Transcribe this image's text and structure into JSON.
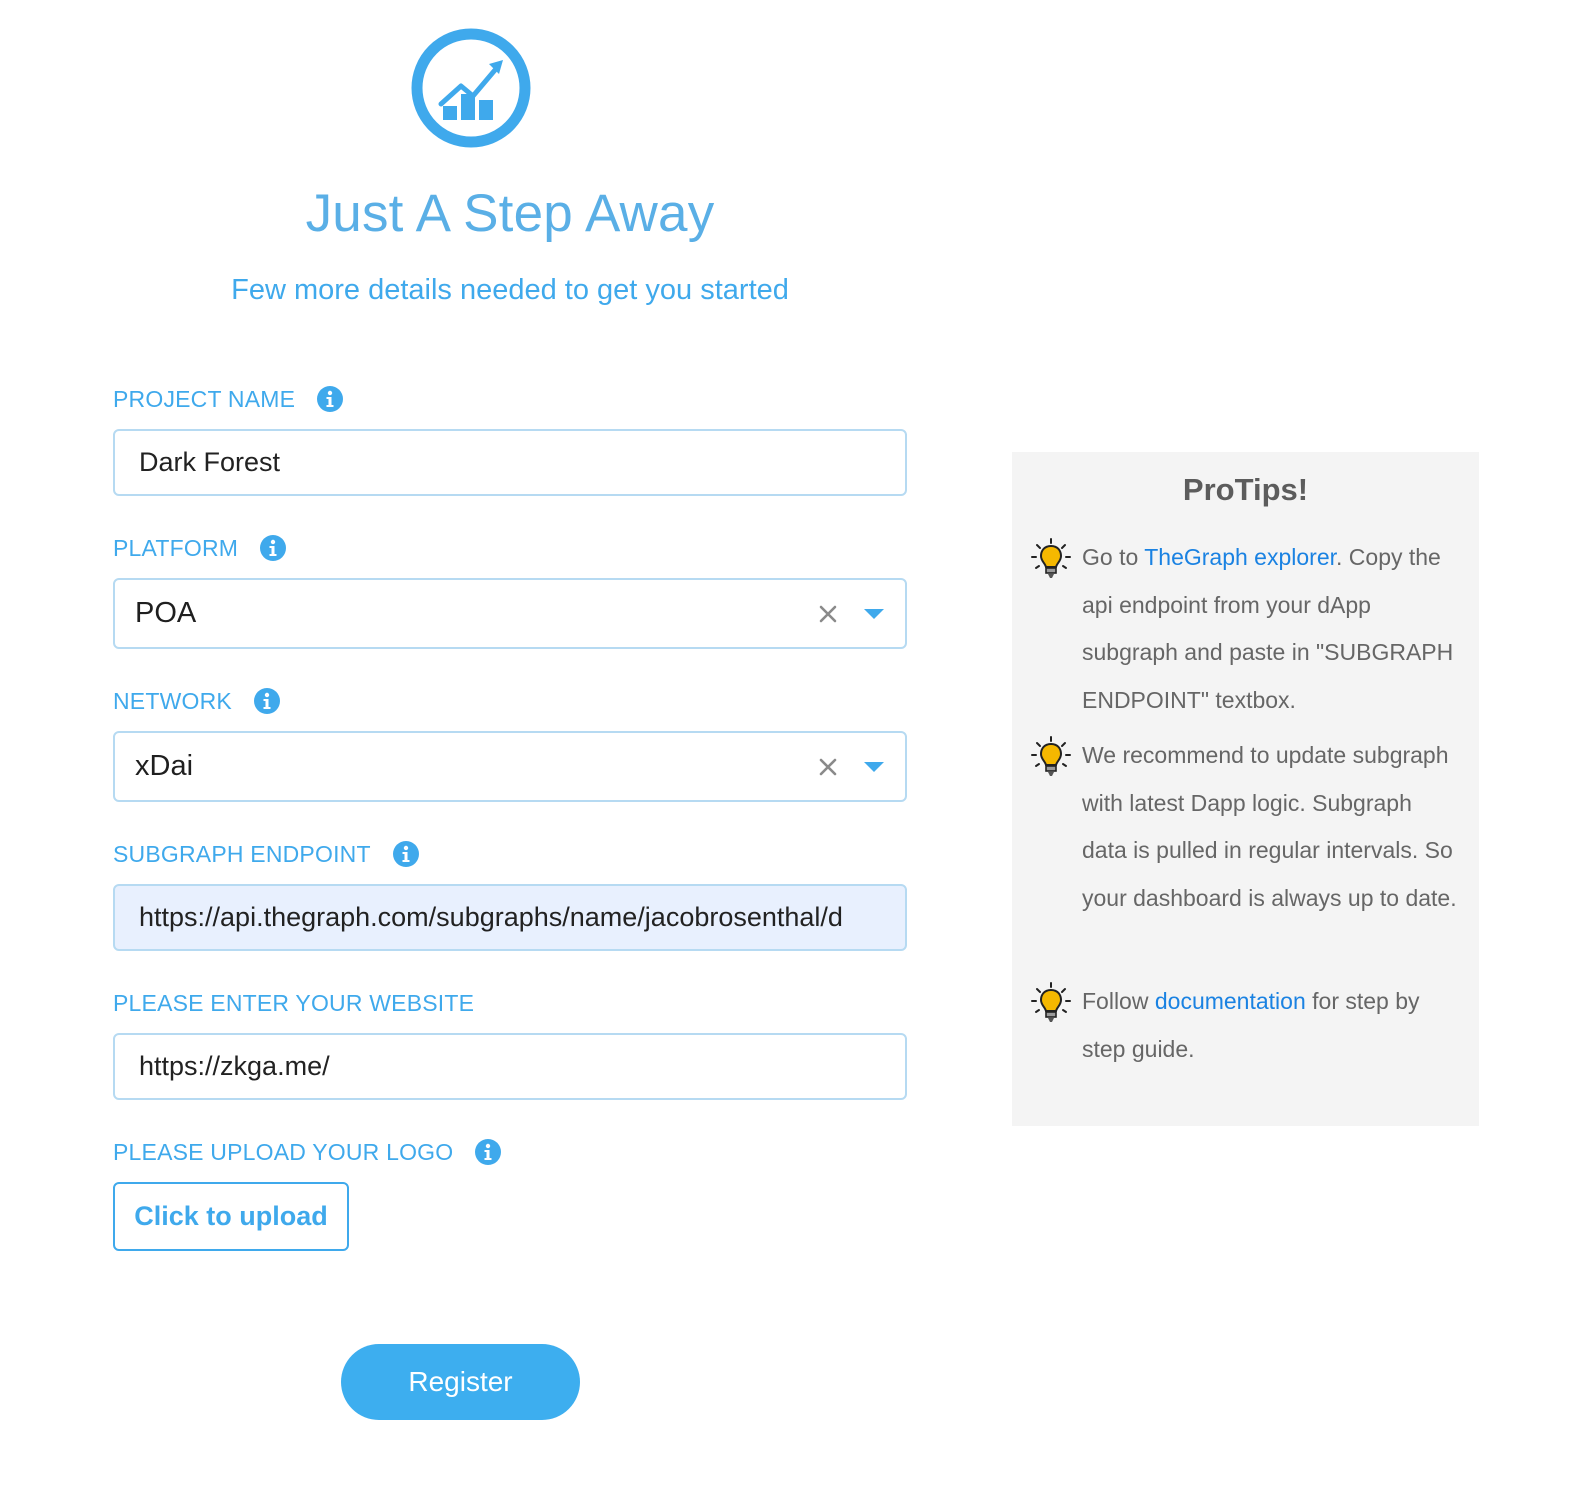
{
  "header": {
    "title": "Just A Step Away",
    "subtitle": "Few more details needed to get you started",
    "logo_icon": "chart-growth-icon"
  },
  "form": {
    "project_name": {
      "label": "PROJECT NAME",
      "value": "Dark Forest"
    },
    "platform": {
      "label": "PLATFORM",
      "value": "POA"
    },
    "network": {
      "label": "NETWORK",
      "value": "xDai"
    },
    "subgraph_endpoint": {
      "label": "SUBGRAPH ENDPOINT",
      "value": "https://api.thegraph.com/subgraphs/name/jacobrosenthal/d"
    },
    "website": {
      "label": "PLEASE ENTER YOUR WEBSITE",
      "value": "https://zkga.me/"
    },
    "logo_upload": {
      "label": "PLEASE UPLOAD YOUR LOGO",
      "button_label": "Click to upload"
    },
    "register_label": "Register"
  },
  "protips": {
    "title": "ProTips!",
    "tips": [
      {
        "before": "Go to ",
        "link": "TheGraph explorer",
        "after": ". Copy the api endpoint from your dApp subgraph and paste in \"SUBGRAPH ENDPOINT\" textbox."
      },
      {
        "text": "We recommend to update subgraph with latest Dapp logic. Subgraph data is pulled in regular intervals. So your dashboard is always up to date."
      },
      {
        "before": "Follow ",
        "link": "documentation",
        "after": " for step by step guide."
      }
    ]
  },
  "colors": {
    "accent": "#3fa9ec",
    "title": "#5aafe6",
    "input_border": "#b6daf2",
    "autofill_bg": "#e8f0fe",
    "register_bg": "#3daeef",
    "panel_bg": "#f4f4f4",
    "link": "#1a82e2",
    "bulb": "#f5b800"
  }
}
